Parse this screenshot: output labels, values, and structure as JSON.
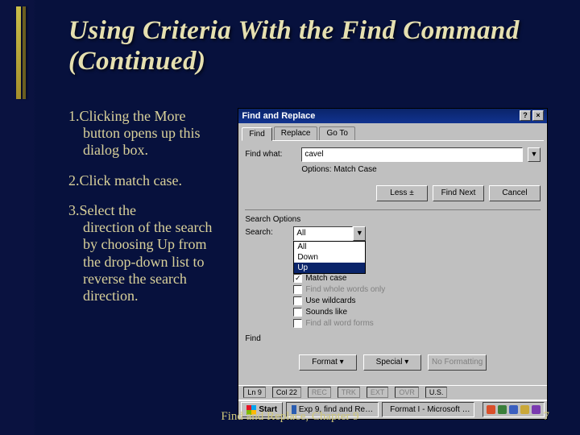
{
  "title": "Using Criteria With the Find Command (Continued)",
  "steps": [
    {
      "num": "1.",
      "lead": "Clicking the More",
      "body": "button opens up this dialog box."
    },
    {
      "num": "2.",
      "lead": "Click match case.",
      "body": ""
    },
    {
      "num": "3.",
      "lead": "Select the",
      "body": "direction of the search by choosing Up from the drop-down list to reverse the search direction."
    }
  ],
  "dialog": {
    "title": "Find and Replace",
    "help_btn": "?",
    "close_btn": "×",
    "tabs": {
      "find": "Find",
      "replace": "Replace",
      "goto": "Go To"
    },
    "find_what_label": "Find what:",
    "find_what_value": "cavel",
    "options_label": "Options:",
    "options_value": "Match Case",
    "buttons": {
      "less": "Less ±",
      "find_next": "Find Next",
      "cancel": "Cancel"
    },
    "search_options_title": "Search Options",
    "search_label": "Search:",
    "search_value": "All",
    "search_items": {
      "all": "All",
      "down": "Down",
      "up": "Up"
    },
    "checks": {
      "match_case": "Match case",
      "whole_words": "Find whole words only",
      "wildcards": "Use wildcards",
      "sounds_like": "Sounds like",
      "word_forms": "Find all word forms"
    },
    "find_group": "Find",
    "format_btn": "Format ▾",
    "special_btn": "Special ▾",
    "noformat_btn": "No Formatting"
  },
  "statusbar": {
    "ln": "Ln 9",
    "col": "Col 22",
    "rec": "REC",
    "trk": "TRK",
    "ext": "EXT",
    "ovr": "OVR",
    "lang": "U.S."
  },
  "taskbar": {
    "start": "Start",
    "task1": "Exp 9, find and Re…",
    "task2": "Format I - Microsoft …"
  },
  "footer": {
    "chapter": "Find and Replace, Chapter 9",
    "page": "7"
  }
}
